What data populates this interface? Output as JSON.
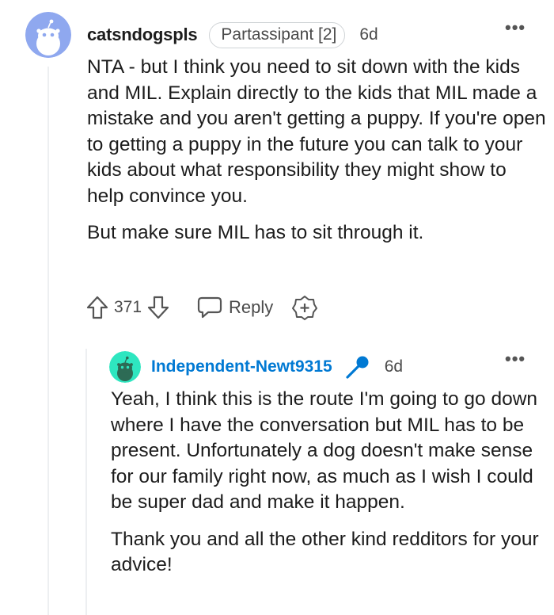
{
  "comment": {
    "username": "catsndogspls",
    "flair": "Partassipant [2]",
    "time": "6d",
    "more_label": "•••",
    "paragraphs": [
      "NTA - but I think you need to sit down with the kids and MIL. Explain directly to the kids that MIL made a mistake and you aren't getting a puppy. If you're open to getting a puppy in the future you can talk to your kids about what responsibility they might show to help convince you.",
      "But make sure MIL has to sit through it."
    ],
    "votes": "371",
    "reply_label": "Reply",
    "avatar_color": "#8fa8ef"
  },
  "reply": {
    "username": "Independent-Newt9315",
    "time": "6d",
    "more_label": "•••",
    "paragraphs": [
      "Yeah, I think this is the route I'm going to go down where I have the conversation but MIL has to be present. Unfortunately a dog doesn't make sense for our family right now, as much as I wish I could be super dad and make it happen.",
      "Thank you and all the other kind redditors for your advice!"
    ],
    "avatar_color": "#2ee6c0",
    "op_color": "#0079d3"
  },
  "icons": {
    "upvote": "arrow-up-icon",
    "downvote": "arrow-down-icon",
    "reply": "speech-bubble-icon",
    "award": "award-plus-icon",
    "op": "microphone-icon",
    "more": "more-dots-icon"
  }
}
